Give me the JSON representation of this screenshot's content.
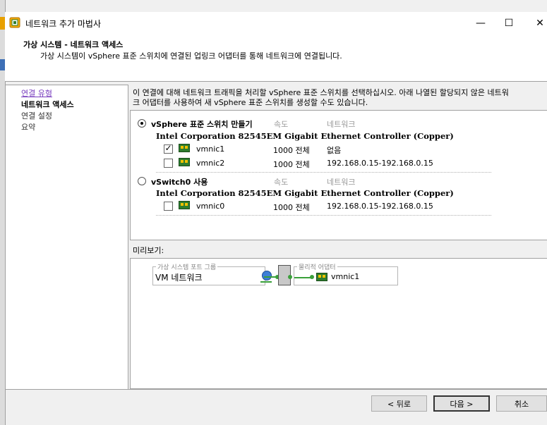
{
  "window": {
    "title": "네트워크 추가 마법사",
    "minimize_glyph": "—",
    "maximize_glyph": "☐",
    "close_glyph": "✕"
  },
  "header": {
    "title": "가상 시스템 - 네트워크 액세스",
    "subtitle": "가상 시스템이 vSphere 표준 스위치에 연결된 업링크 어댑터를 통해 네트워크에 연결됩니다."
  },
  "nav": {
    "items": [
      {
        "label": "연결 유형",
        "state": "link"
      },
      {
        "label": "네트워크 액세스",
        "state": "current"
      },
      {
        "label": "연결 설정",
        "state": "pending"
      },
      {
        "label": "요약",
        "state": "pending"
      }
    ]
  },
  "main": {
    "description_line1": "이 연결에 대해 네트워크 트래픽을 처리할 vSphere 표준 스위치를 선택하십시오. 아래 나열된 할당되지 않은 네트워",
    "description_line2": "크 어댑터를 사용하여 새 vSphere 표준 스위치를 생성할 수도 있습니다.",
    "col_speed": "속도",
    "col_network": "네트워크",
    "options": [
      {
        "label": "vSphere 표준 스위치 만들기",
        "selected": true,
        "adapter_title": "Intel Corporation 82545EM Gigabit Ethernet Controller (Copper)",
        "nics": [
          {
            "name": "vmnic1",
            "checked": true,
            "speed": "1000 전체",
            "network": "없음"
          },
          {
            "name": "vmnic2",
            "checked": false,
            "speed": "1000 전체",
            "network": "192.168.0.15-192.168.0.15"
          }
        ]
      },
      {
        "label": "vSwitch0 사용",
        "selected": false,
        "adapter_title": "Intel Corporation 82545EM Gigabit Ethernet Controller (Copper)",
        "nics": [
          {
            "name": "vmnic0",
            "checked": false,
            "speed": "1000 전체",
            "network": "192.168.0.15-192.168.0.15"
          }
        ]
      }
    ],
    "check_glyph": "✓"
  },
  "preview": {
    "label": "미리보기:",
    "portgroup_legend": "가상 시스템 포트 그룹",
    "portgroup_name": "VM 네트워크",
    "physical_legend": "물리적 어댑터",
    "physical_nic": "vmnic1"
  },
  "footer": {
    "back_label": "< 뒤로",
    "next_label": "다음 >",
    "cancel_label": "취소"
  },
  "colors": {
    "nav_link": "#7a3fbf",
    "nic_green": "#2e7d2e",
    "link_green": "#3aa03a"
  }
}
